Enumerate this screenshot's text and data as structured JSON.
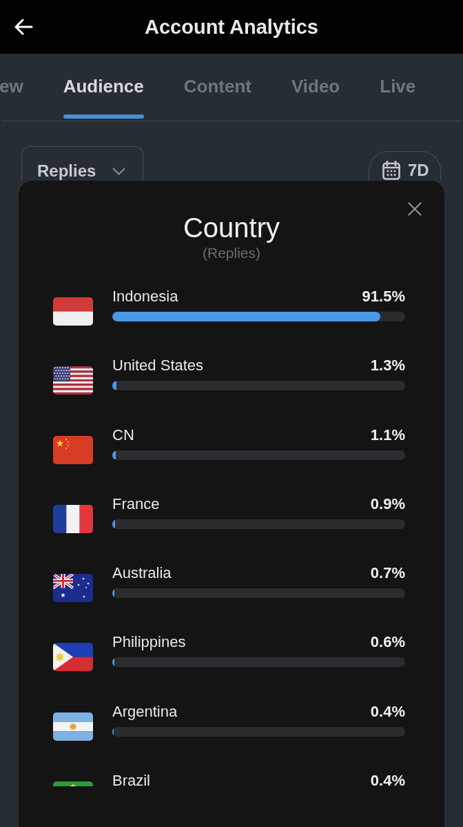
{
  "header": {
    "title": "Account Analytics"
  },
  "tabs": [
    {
      "label": "ew",
      "selected": false
    },
    {
      "label": "Audience",
      "selected": true
    },
    {
      "label": "Content",
      "selected": false
    },
    {
      "label": "Video",
      "selected": false
    },
    {
      "label": "Live",
      "selected": false
    }
  ],
  "filters": {
    "metric": "Replies",
    "range": "7D"
  },
  "modal": {
    "title": "Country",
    "subtitle": "(Replies)",
    "items": [
      {
        "kind": "id",
        "name": "Indonesia",
        "value": "91.5%",
        "level": 0.915
      },
      {
        "kind": "us",
        "name": "United States",
        "value": "1.3%",
        "level": 0.013
      },
      {
        "kind": "cn",
        "name": "CN",
        "value": "1.1%",
        "level": 0.011
      },
      {
        "kind": "fr",
        "name": "France",
        "value": "0.9%",
        "level": 0.009
      },
      {
        "kind": "au",
        "name": "Australia",
        "value": "0.7%",
        "level": 0.007
      },
      {
        "kind": "ph",
        "name": "Philippines",
        "value": "0.6%",
        "level": 0.006
      },
      {
        "kind": "ar",
        "name": "Argentina",
        "value": "0.4%",
        "level": 0.004
      },
      {
        "kind": "br",
        "name": "Brazil",
        "value": "0.4%"
      }
    ]
  }
}
